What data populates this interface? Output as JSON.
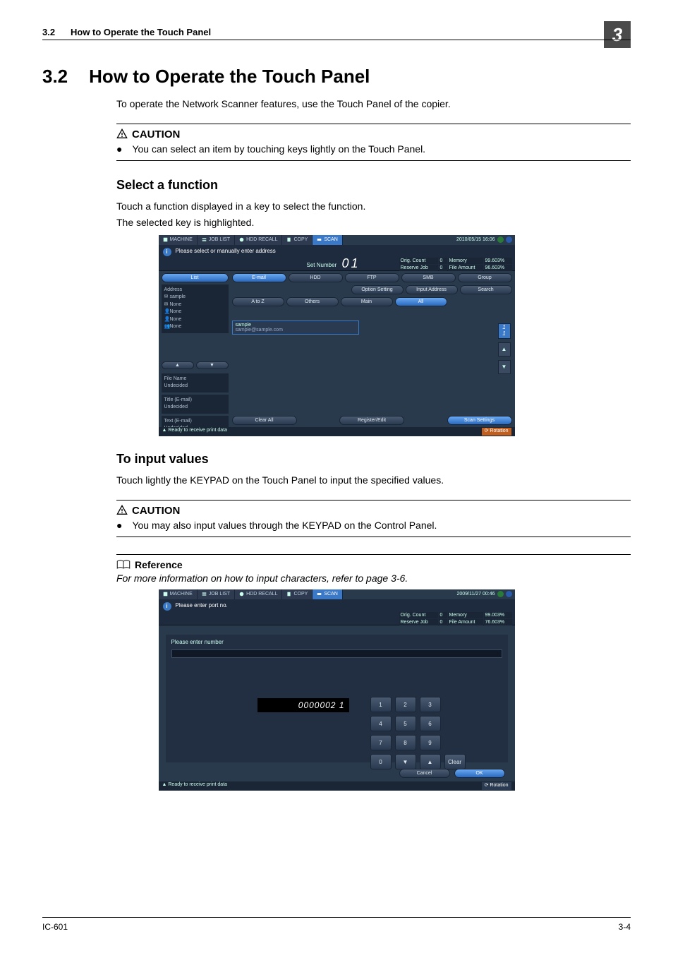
{
  "page": {
    "section_number": "3.2",
    "running_head": "How to Operate the Touch Panel",
    "chapter_badge": "3",
    "title": "How to Operate the Touch Panel",
    "intro": "To operate the Network Scanner features, use the Touch Panel of the copier.",
    "footer_left": "IC-601",
    "footer_right": "3-4"
  },
  "caution1": {
    "heading": "CAUTION",
    "bullet": "You can select an item by touching keys lightly on the Touch Panel."
  },
  "select": {
    "heading": "Select a function",
    "line1": "Touch a function displayed in a key to select the function.",
    "line2": "The selected key is highlighted."
  },
  "input": {
    "heading": "To input values",
    "line1": "Touch lightly the KEYPAD on the Touch Panel to input the specified values."
  },
  "caution2": {
    "heading": "CAUTION",
    "bullet": "You may also input values through the KEYPAD on the Control Panel."
  },
  "reference": {
    "heading": "Reference",
    "text": "For more information on how to input characters, refer to page 3-6."
  },
  "shot1": {
    "tabs": {
      "machine": "MACHINE",
      "joblist": "JOB LIST",
      "hddrecall": "HDD RECALL",
      "copy": "COPY",
      "scan": "SCAN"
    },
    "datetime": "2010/05/15 16:06",
    "message": "Please select or manually enter address",
    "set_number_label": "Set Number",
    "set_number_value": "0 1",
    "stats": {
      "orig_l": "Orig. Count",
      "orig_v": "0",
      "mem_l": "Memory",
      "mem_v": "99.603%",
      "res_l": "Reserve Job",
      "res_v": "0",
      "file_l": "File Amount",
      "file_v": "96.603%"
    },
    "left": {
      "list": "List",
      "addr_h": "Address",
      "addr_v": "sample",
      "none": "None",
      "file_h": "File Name",
      "file_v": "Undecided",
      "title_h": "Title (E-mail)",
      "title_v": "Undecided",
      "text_h": "Text (E-mail)",
      "text_v": "Undecided"
    },
    "dest_tabs": {
      "email": "E-mail",
      "hdd": "HDD",
      "ftp": "FTP",
      "smb": "SMB",
      "group": "Group"
    },
    "opts": {
      "option": "Option Setting",
      "input": "Input Address",
      "search": "Search"
    },
    "filter": {
      "atoz": "A to Z",
      "others": "Others",
      "main": "Main",
      "all": "All"
    },
    "entry": {
      "name": "sample",
      "addr": "sample@sample.com"
    },
    "scroll_count": "1\n1",
    "bottom": {
      "clear": "Clear All",
      "reg": "Register/Edit",
      "scan": "Scan Settings"
    },
    "status": "Ready to receive print data",
    "rotation": "Rotation"
  },
  "shot2": {
    "datetime": "2009/11/27 00:46",
    "message": "Please enter port no.",
    "stats": {
      "orig_l": "Orig. Count",
      "orig_v": "0",
      "mem_l": "Memory",
      "mem_v": "99.003%",
      "res_l": "Reserve Job",
      "res_v": "0",
      "file_l": "File Amount",
      "file_v": "76.603%"
    },
    "prompt": "Please enter number",
    "display": "0000002 1",
    "keys": [
      "1",
      "2",
      "3",
      "",
      "4",
      "5",
      "6",
      "",
      "7",
      "8",
      "9",
      "",
      "0",
      "▼",
      "▲",
      "Clear"
    ],
    "cancel": "Cancel",
    "ok": "OK",
    "status": "Ready to receive print data",
    "rotation": "Rotation"
  }
}
